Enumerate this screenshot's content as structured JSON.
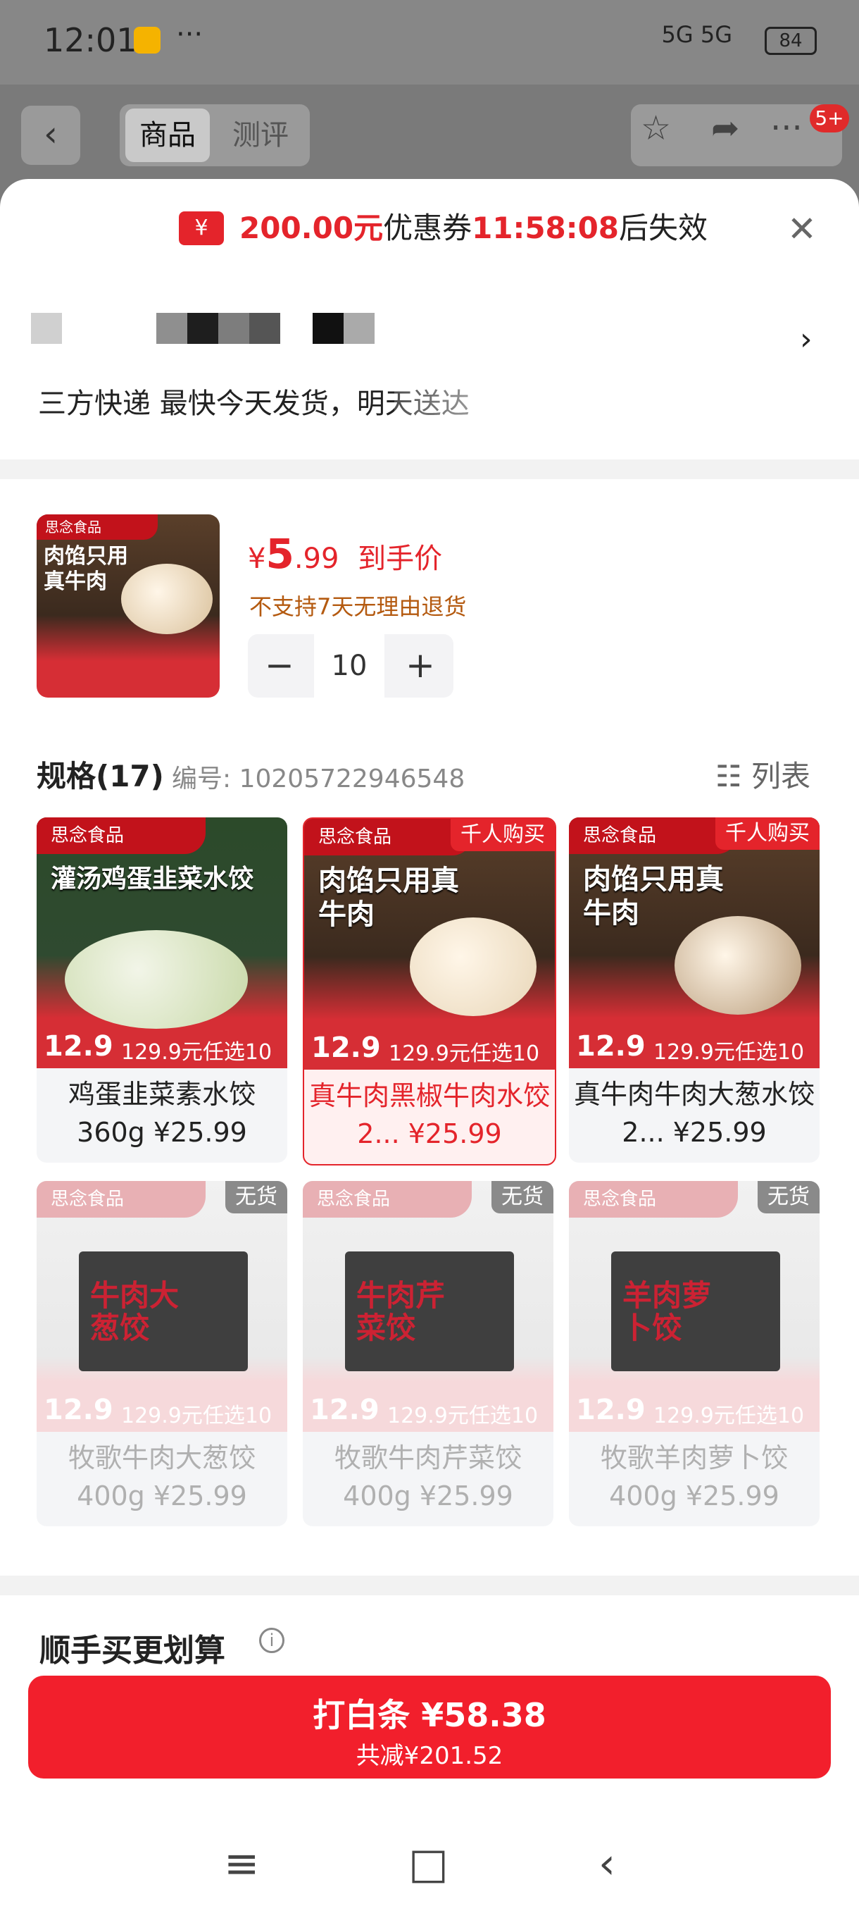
{
  "status_bar": {
    "time": "12:01",
    "more": "···",
    "signal": "5G 5G",
    "battery": "84"
  },
  "header": {
    "back": "‹",
    "tabs": [
      "商品",
      "测评"
    ],
    "icons": [
      "star-icon",
      "share-icon",
      "more-icon"
    ],
    "cart_badge": "5+"
  },
  "coupon": {
    "amount": "200.00元",
    "label": "优惠券",
    "countdown": "11:58:08",
    "suffix": "后失效",
    "ticket_symbol": "¥"
  },
  "shipping": {
    "text": "三方快递 最快今天发货，明天送达"
  },
  "product": {
    "thumb_title": "肉馅只用真牛肉",
    "thumb_brand": "思念食品",
    "price_symbol": "¥",
    "price_int": "5",
    "price_dec": ".99",
    "price_label": "到手价",
    "return_policy": "不支持7天无理由退货",
    "quantity": "10"
  },
  "spec": {
    "title": "规格(17)",
    "code": "编号: 10205722946548",
    "view_label": "列表"
  },
  "variants": [
    {
      "brand": "思念食品",
      "headline": "灌汤鸡蛋韭菜水饺",
      "price_tag": "12.9",
      "promo": "129.9元任选10件",
      "name": "鸡蛋韭菜素水饺360g ¥25.99",
      "tag": "",
      "state": "normal"
    },
    {
      "brand": "思念食品",
      "headline": "肉馅只用真牛肉",
      "price_tag": "12.9",
      "promo": "129.9元任选10件",
      "name": "真牛肉黑椒牛肉水饺2... ¥25.99",
      "tag": "千人购买",
      "state": "selected"
    },
    {
      "brand": "思念食品",
      "headline": "肉馅只用真牛肉",
      "price_tag": "12.9",
      "promo": "129.9元任选10件",
      "name": "真牛肉牛肉大葱水饺2... ¥25.99",
      "tag": "千人购买",
      "state": "normal"
    },
    {
      "brand": "思念食品",
      "headline": "牛肉大葱饺",
      "price_tag": "12.9",
      "promo": "129.9元任选10件",
      "name": "牧歌牛肉大葱饺400g ¥25.99",
      "tag": "无货",
      "state": "disabled"
    },
    {
      "brand": "思念食品",
      "headline": "牛肉芹菜饺",
      "price_tag": "12.9",
      "promo": "129.9元任选10件",
      "name": "牧歌牛肉芹菜饺400g ¥25.99",
      "tag": "无货",
      "state": "disabled"
    },
    {
      "brand": "思念食品",
      "headline": "羊肉萝卜饺",
      "price_tag": "12.9",
      "promo": "129.9元任选10件",
      "name": "牧歌羊肉萝卜饺400g ¥25.99",
      "tag": "无货",
      "state": "disabled"
    }
  ],
  "section": {
    "more_deals": "顺手买更划算",
    "info": "i"
  },
  "buy_button": {
    "line1": "打白条 ¥58.38",
    "line2": "共减¥201.52"
  },
  "nav": [
    "≡",
    "□",
    "‹"
  ]
}
